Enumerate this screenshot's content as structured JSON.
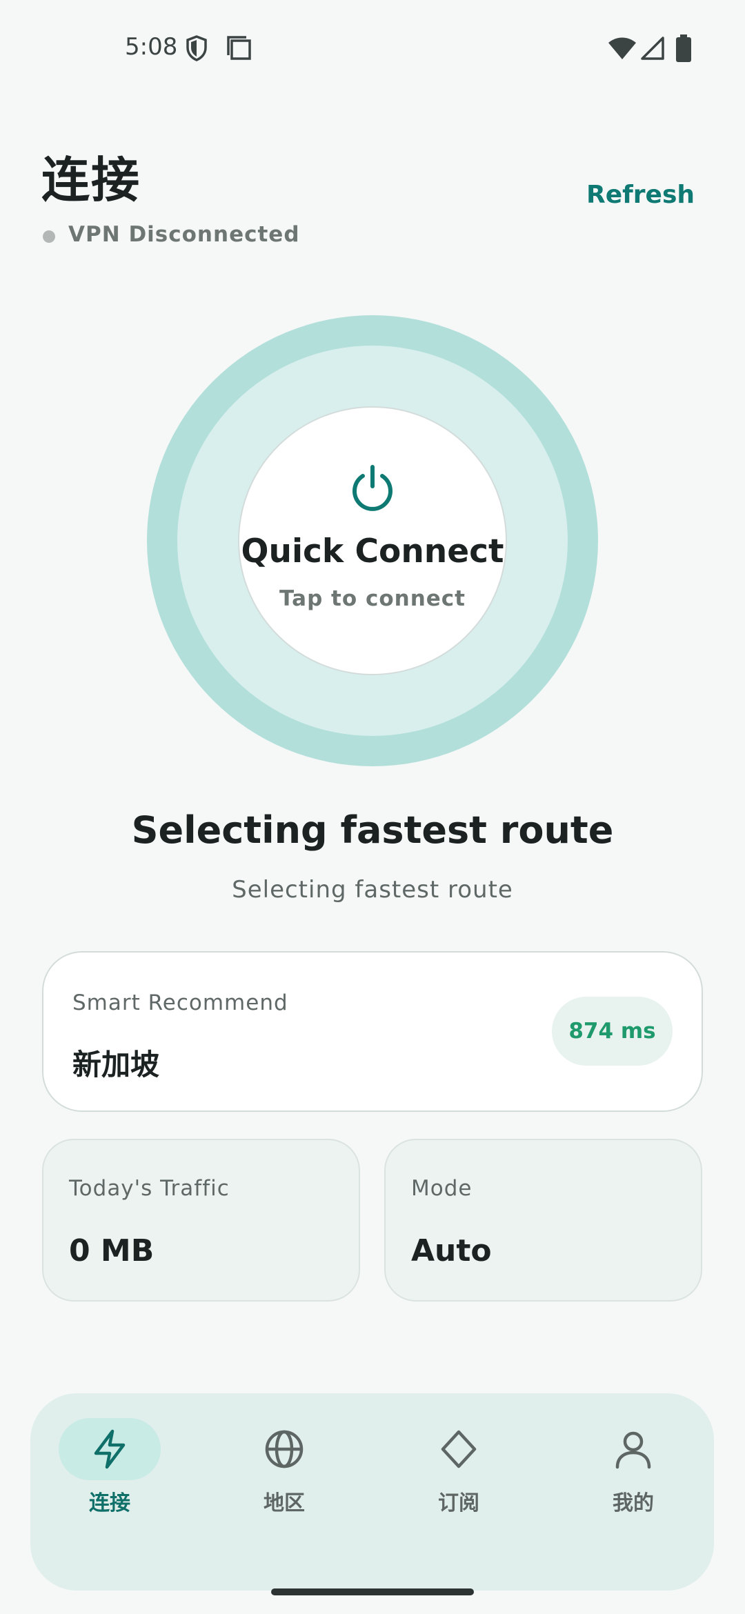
{
  "status_bar": {
    "time": "5:08",
    "icons": [
      "shield-icon",
      "clipboard-icon",
      "wifi-icon",
      "signal-icon",
      "battery-icon"
    ]
  },
  "header": {
    "title": "连接",
    "status": "VPN Disconnected",
    "refresh_label": "Refresh"
  },
  "connect": {
    "title": "Quick Connect",
    "subtitle": "Tap to connect",
    "icon": "power-icon"
  },
  "route": {
    "title": "Selecting fastest route",
    "subtitle": "Selecting fastest route"
  },
  "recommend": {
    "label": "Smart Recommend",
    "location": "新加坡",
    "ping": "874 ms"
  },
  "stats": {
    "traffic_label": "Today's Traffic",
    "traffic_value": "0 MB",
    "mode_label": "Mode",
    "mode_value": "Auto"
  },
  "nav": {
    "items": [
      {
        "label": "连接",
        "icon": "bolt-icon",
        "active": true
      },
      {
        "label": "地区",
        "icon": "globe-icon",
        "active": false
      },
      {
        "label": "订阅",
        "icon": "diamond-icon",
        "active": false
      },
      {
        "label": "我的",
        "icon": "person-icon",
        "active": false
      }
    ]
  },
  "colors": {
    "accent": "#0f7a73",
    "ring_outer": "#b3dfdb",
    "ring_inner": "#d8efed",
    "ping_green": "#1f9a6c",
    "background": "#f5f8f7"
  }
}
